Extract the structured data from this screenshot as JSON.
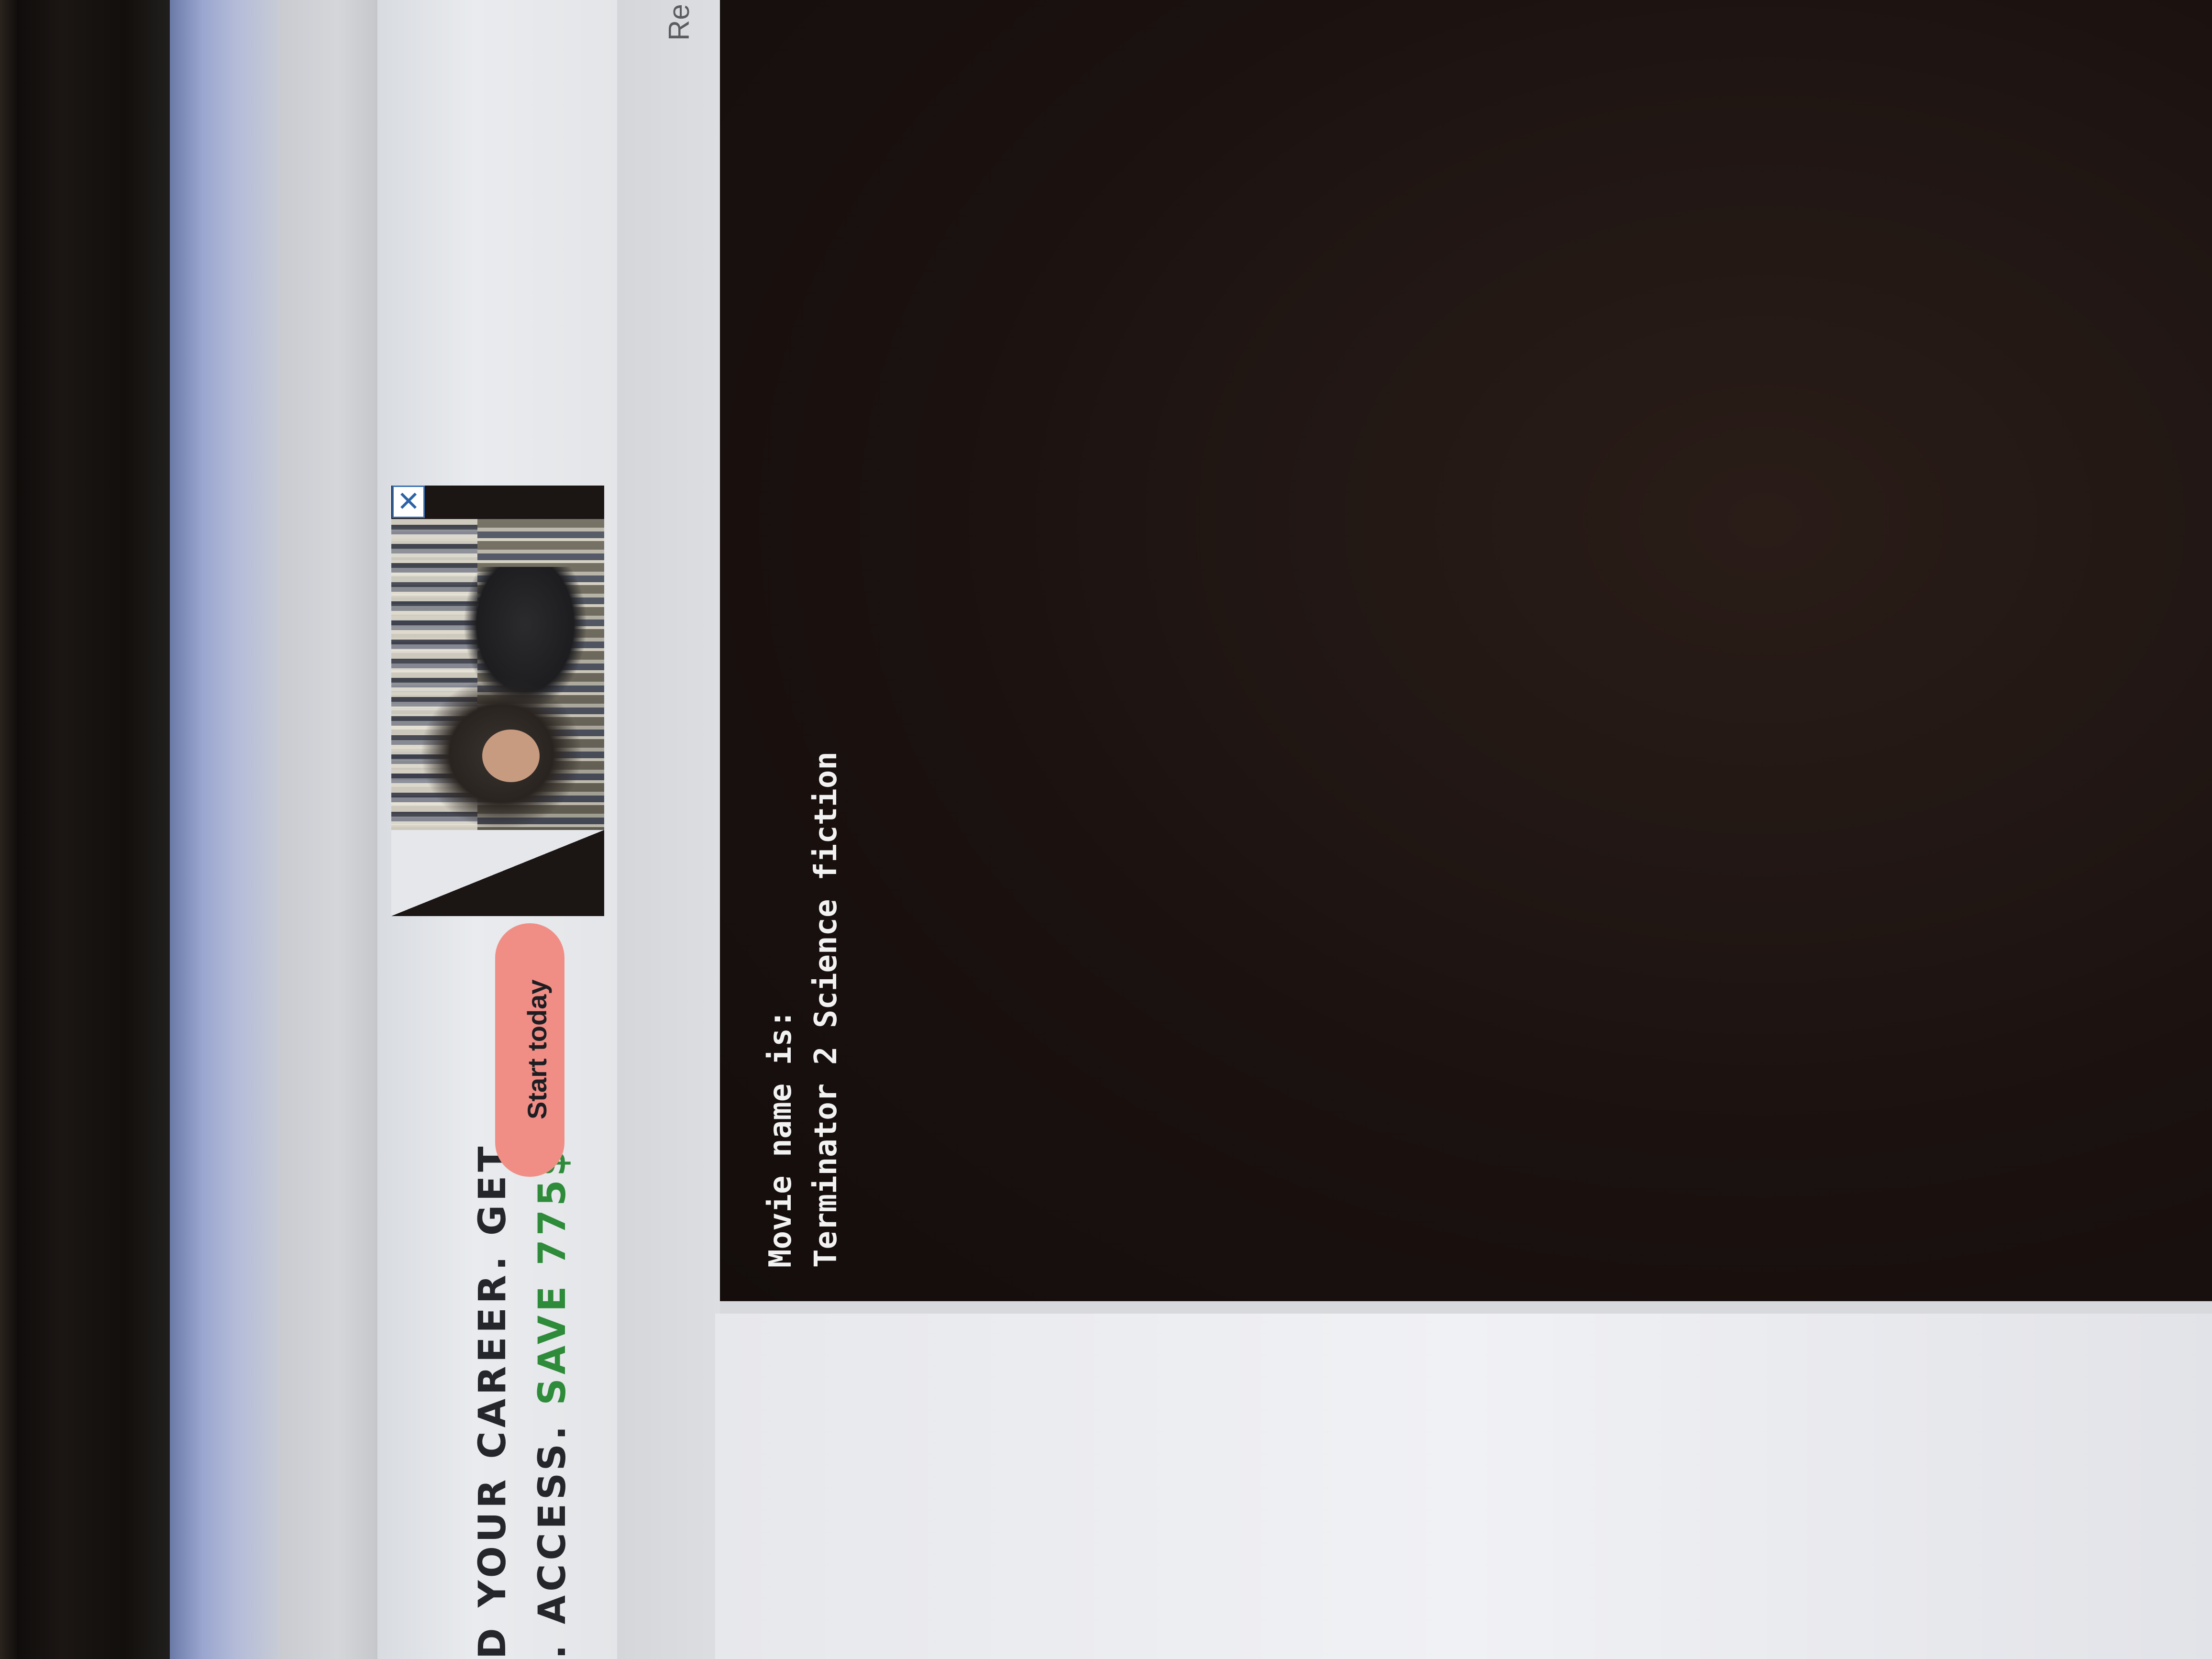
{
  "ad": {
    "headline_line1": "D YOUR CAREER. GET",
    "headline_line2_prefix": ". ACCESS. ",
    "headline_line2_highlight": "SAVE 775$",
    "cta_label": "Start today",
    "close_glyph": "✕",
    "highlight_color": "#2e8b3a",
    "cta_color": "#f08e86"
  },
  "page": {
    "corner_text": "Re"
  },
  "console": {
    "lines": [
      "Movie name is:",
      "Terminator 2 Science fiction"
    ]
  }
}
